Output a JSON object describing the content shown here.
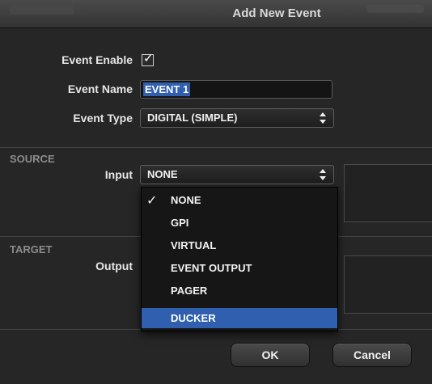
{
  "dialog": {
    "title": "Add New Event"
  },
  "form": {
    "event_enable_label": "Event Enable",
    "event_enable_checked": true,
    "event_name_label": "Event Name",
    "event_name_value": "EVENT 1",
    "event_type_label": "Event Type",
    "event_type_value": "DIGITAL (SIMPLE)"
  },
  "source": {
    "section_title": "SOURCE",
    "input_label": "Input",
    "input_value": "NONE"
  },
  "target": {
    "section_title": "TARGET",
    "output_label": "Output"
  },
  "dropdown": {
    "items": [
      {
        "label": "NONE",
        "checked": true
      },
      {
        "label": "GPI",
        "checked": false
      },
      {
        "label": "VIRTUAL",
        "checked": false
      },
      {
        "label": "EVENT OUTPUT",
        "checked": false
      },
      {
        "label": "PAGER",
        "checked": false
      },
      {
        "label": "DUCKER",
        "checked": false,
        "highlighted": true
      }
    ],
    "check_glyph": "✓"
  },
  "buttons": {
    "ok_label": "OK",
    "cancel_label": "Cancel"
  },
  "colors": {
    "highlight": "#2f5fae",
    "background": "#262626"
  },
  "icons": {
    "checkbox": "checkbox-checked-icon",
    "select_arrows": "updown-arrows-icon",
    "check": "checkmark-icon"
  }
}
